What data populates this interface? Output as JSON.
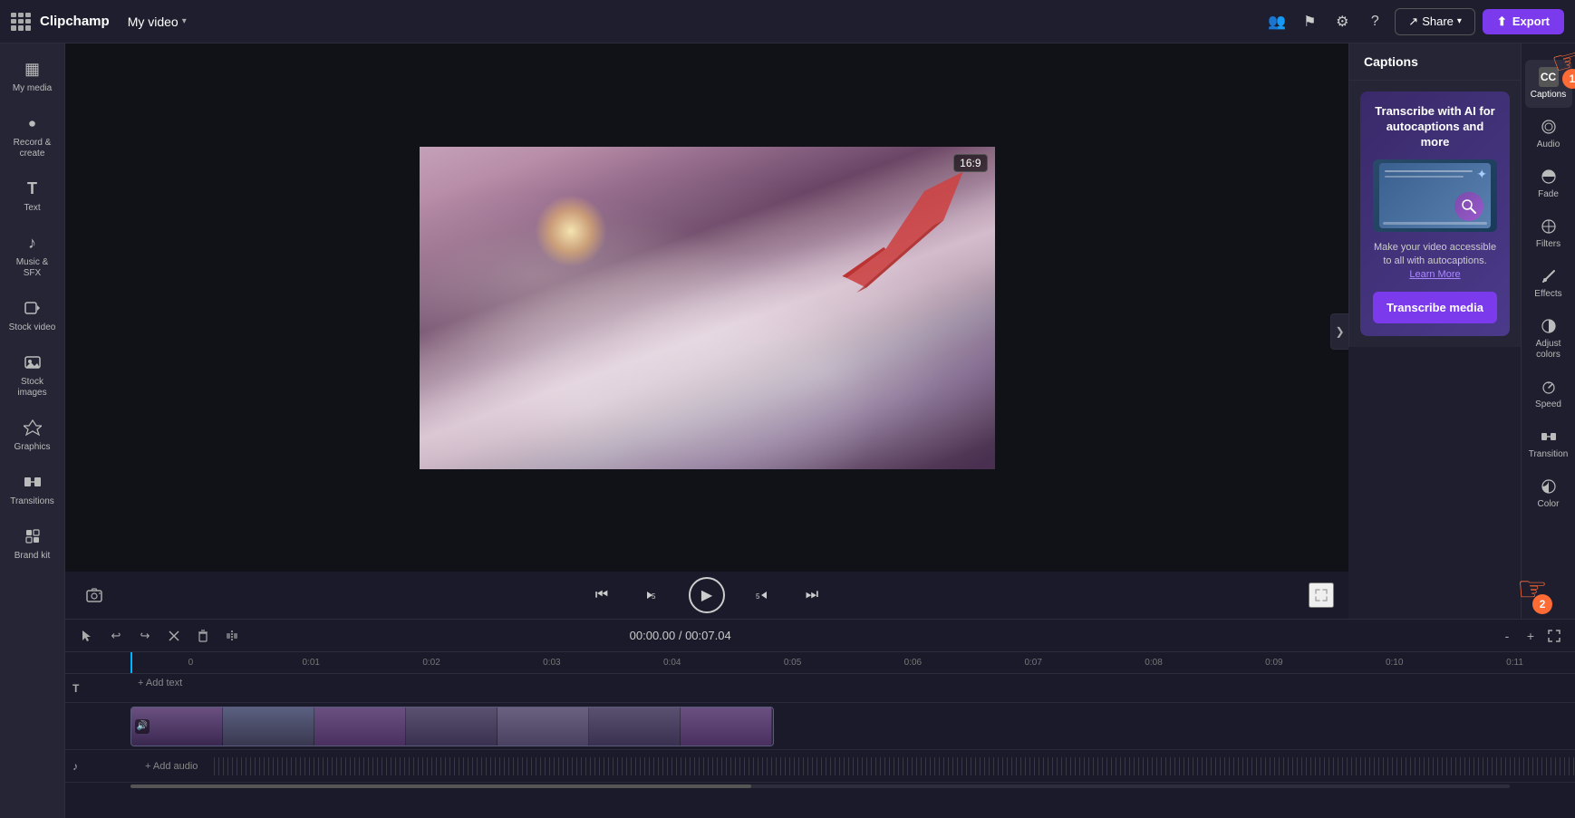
{
  "app": {
    "name": "Clipchamp",
    "video_title": "My video",
    "chevron": "▾"
  },
  "topbar": {
    "share_label": "Share",
    "export_label": "Export",
    "share_icon": "↗",
    "export_icon": "⬆"
  },
  "left_sidebar": {
    "items": [
      {
        "id": "my-media",
        "icon": "▦",
        "label": "My media"
      },
      {
        "id": "record-create",
        "icon": "⏺",
        "label": "Record & create"
      },
      {
        "id": "text",
        "icon": "T",
        "label": "Text"
      },
      {
        "id": "music-sfx",
        "icon": "♪",
        "label": "Music & SFX"
      },
      {
        "id": "stock-video",
        "icon": "🎬",
        "label": "Stock video"
      },
      {
        "id": "stock-images",
        "icon": "🖼",
        "label": "Stock images"
      },
      {
        "id": "graphics",
        "icon": "✦",
        "label": "Graphics"
      },
      {
        "id": "transitions",
        "icon": "⇄",
        "label": "Transitions"
      },
      {
        "id": "brand-kit",
        "icon": "◈",
        "label": "Brand kit"
      }
    ]
  },
  "video": {
    "aspect_ratio": "16:9",
    "current_time": "00:00.00",
    "total_time": "/ 00:07.04"
  },
  "playback": {
    "skip_back": "⏮",
    "rewind": "↩",
    "play": "▶",
    "forward": "↪",
    "skip_fwd": "⏭",
    "fullscreen": "⛶",
    "screenshot": "📷"
  },
  "timeline": {
    "tools": [
      "✂",
      "↩",
      "↪",
      "✂",
      "🗑",
      "⊞"
    ],
    "time_display": "00:00.00 / 00:07.04",
    "marks": [
      "0:00",
      "0:01",
      "0:02",
      "0:03",
      "0:04",
      "0:05",
      "0:06",
      "0:07",
      "0:08",
      "0:09",
      "0:10",
      "0:11"
    ],
    "track_text_label": "T",
    "add_text": "+ Add text",
    "add_audio": "+ Add audio",
    "zoom_in": "+",
    "zoom_out": "-",
    "expand_icon": "⤡"
  },
  "captions_panel": {
    "title": "Captions",
    "card": {
      "heading": "Transcribe with AI for autocaptions and more",
      "description": "Make your video accessible to all with autocaptions.",
      "learn_more": "Learn More",
      "button_label": "Transcribe media"
    }
  },
  "right_tools": {
    "items": [
      {
        "id": "captions",
        "icon": "CC",
        "label": "Captions",
        "active": true
      },
      {
        "id": "audio",
        "icon": "♪",
        "label": "Audio"
      },
      {
        "id": "fade",
        "icon": "◑",
        "label": "Fade"
      },
      {
        "id": "filters",
        "icon": "⊗",
        "label": "Filters"
      },
      {
        "id": "effects",
        "icon": "✏",
        "label": "Effects"
      },
      {
        "id": "adjust-colors",
        "icon": "◑",
        "label": "Adjust colors"
      },
      {
        "id": "speed",
        "icon": "⏱",
        "label": "Speed"
      },
      {
        "id": "transition",
        "icon": "⇄",
        "label": "Transition"
      },
      {
        "id": "color",
        "icon": "◐",
        "label": "Color"
      }
    ]
  },
  "annotations": {
    "badge_1": "1",
    "badge_2": "2"
  }
}
